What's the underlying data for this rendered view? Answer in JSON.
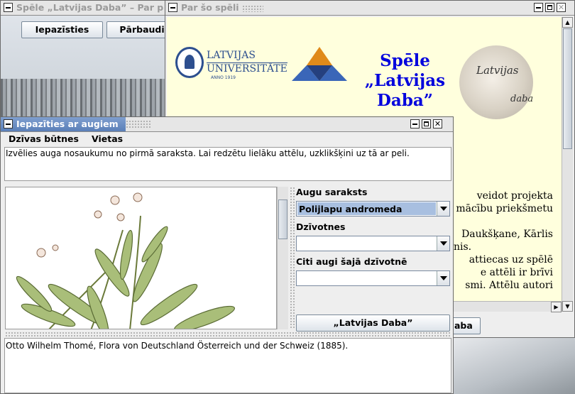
{
  "background_window": {
    "title": "Spēle „Latvijas Daba” – Par p",
    "buttons": {
      "learn": "Iepazīsties",
      "check": "Pārbaudi"
    }
  },
  "about_window": {
    "title": "Par šo spēli",
    "logo_lu_line1": "LATVIJAS",
    "logo_lu_line2": "UNIVERSITĀTE",
    "logo_lu_line3": "ANNO 1919",
    "game_title_line1": "Spēle",
    "game_title_line2": "„Latvijas",
    "game_title_line3": "Daba”",
    "badge_text_1": "Latvijas",
    "badge_text_2": "daba",
    "text_line1": "veidot projekta",
    "text_line2": "mācību priekšmetu",
    "text_line3": "Daukšķane, Kārlis",
    "text_line4": "nis.",
    "text_line5": "attiecas uz spēlē",
    "text_line6": "e attēli ir brīvi",
    "text_line7": "smi. Attēlu autori",
    "bottom_button_partial": "aba"
  },
  "plants_window": {
    "title": "Iepazīties ar augiem",
    "menu": {
      "item1": "Dzīvas būtnes",
      "item2": "Vietas"
    },
    "instruction": "Izvēlies auga nosaukumu no pirmā saraksta. Lai redzētu lielāku attēlu, uzklikšķini uz tā ar peli.",
    "plant_list_label": "Augu saraksts",
    "plant_list_selected": "Polijlapu andromeda",
    "habitat_label": "Dzīvotnes",
    "habitat_selected": "",
    "other_plants_label": "Citi augi šajā dzīvotnē",
    "other_plants_selected": "",
    "game_button": "„Latvijas Daba”",
    "caption": "Otto Wilhelm Thomé, Flora von Deutschland Österreich und der Schweiz (1885)."
  },
  "colors": {
    "title_active": "#6a8cc4",
    "game_title": "#0000dd",
    "about_bg": "#ffffdd",
    "selected_item": "#a8bfe0"
  }
}
